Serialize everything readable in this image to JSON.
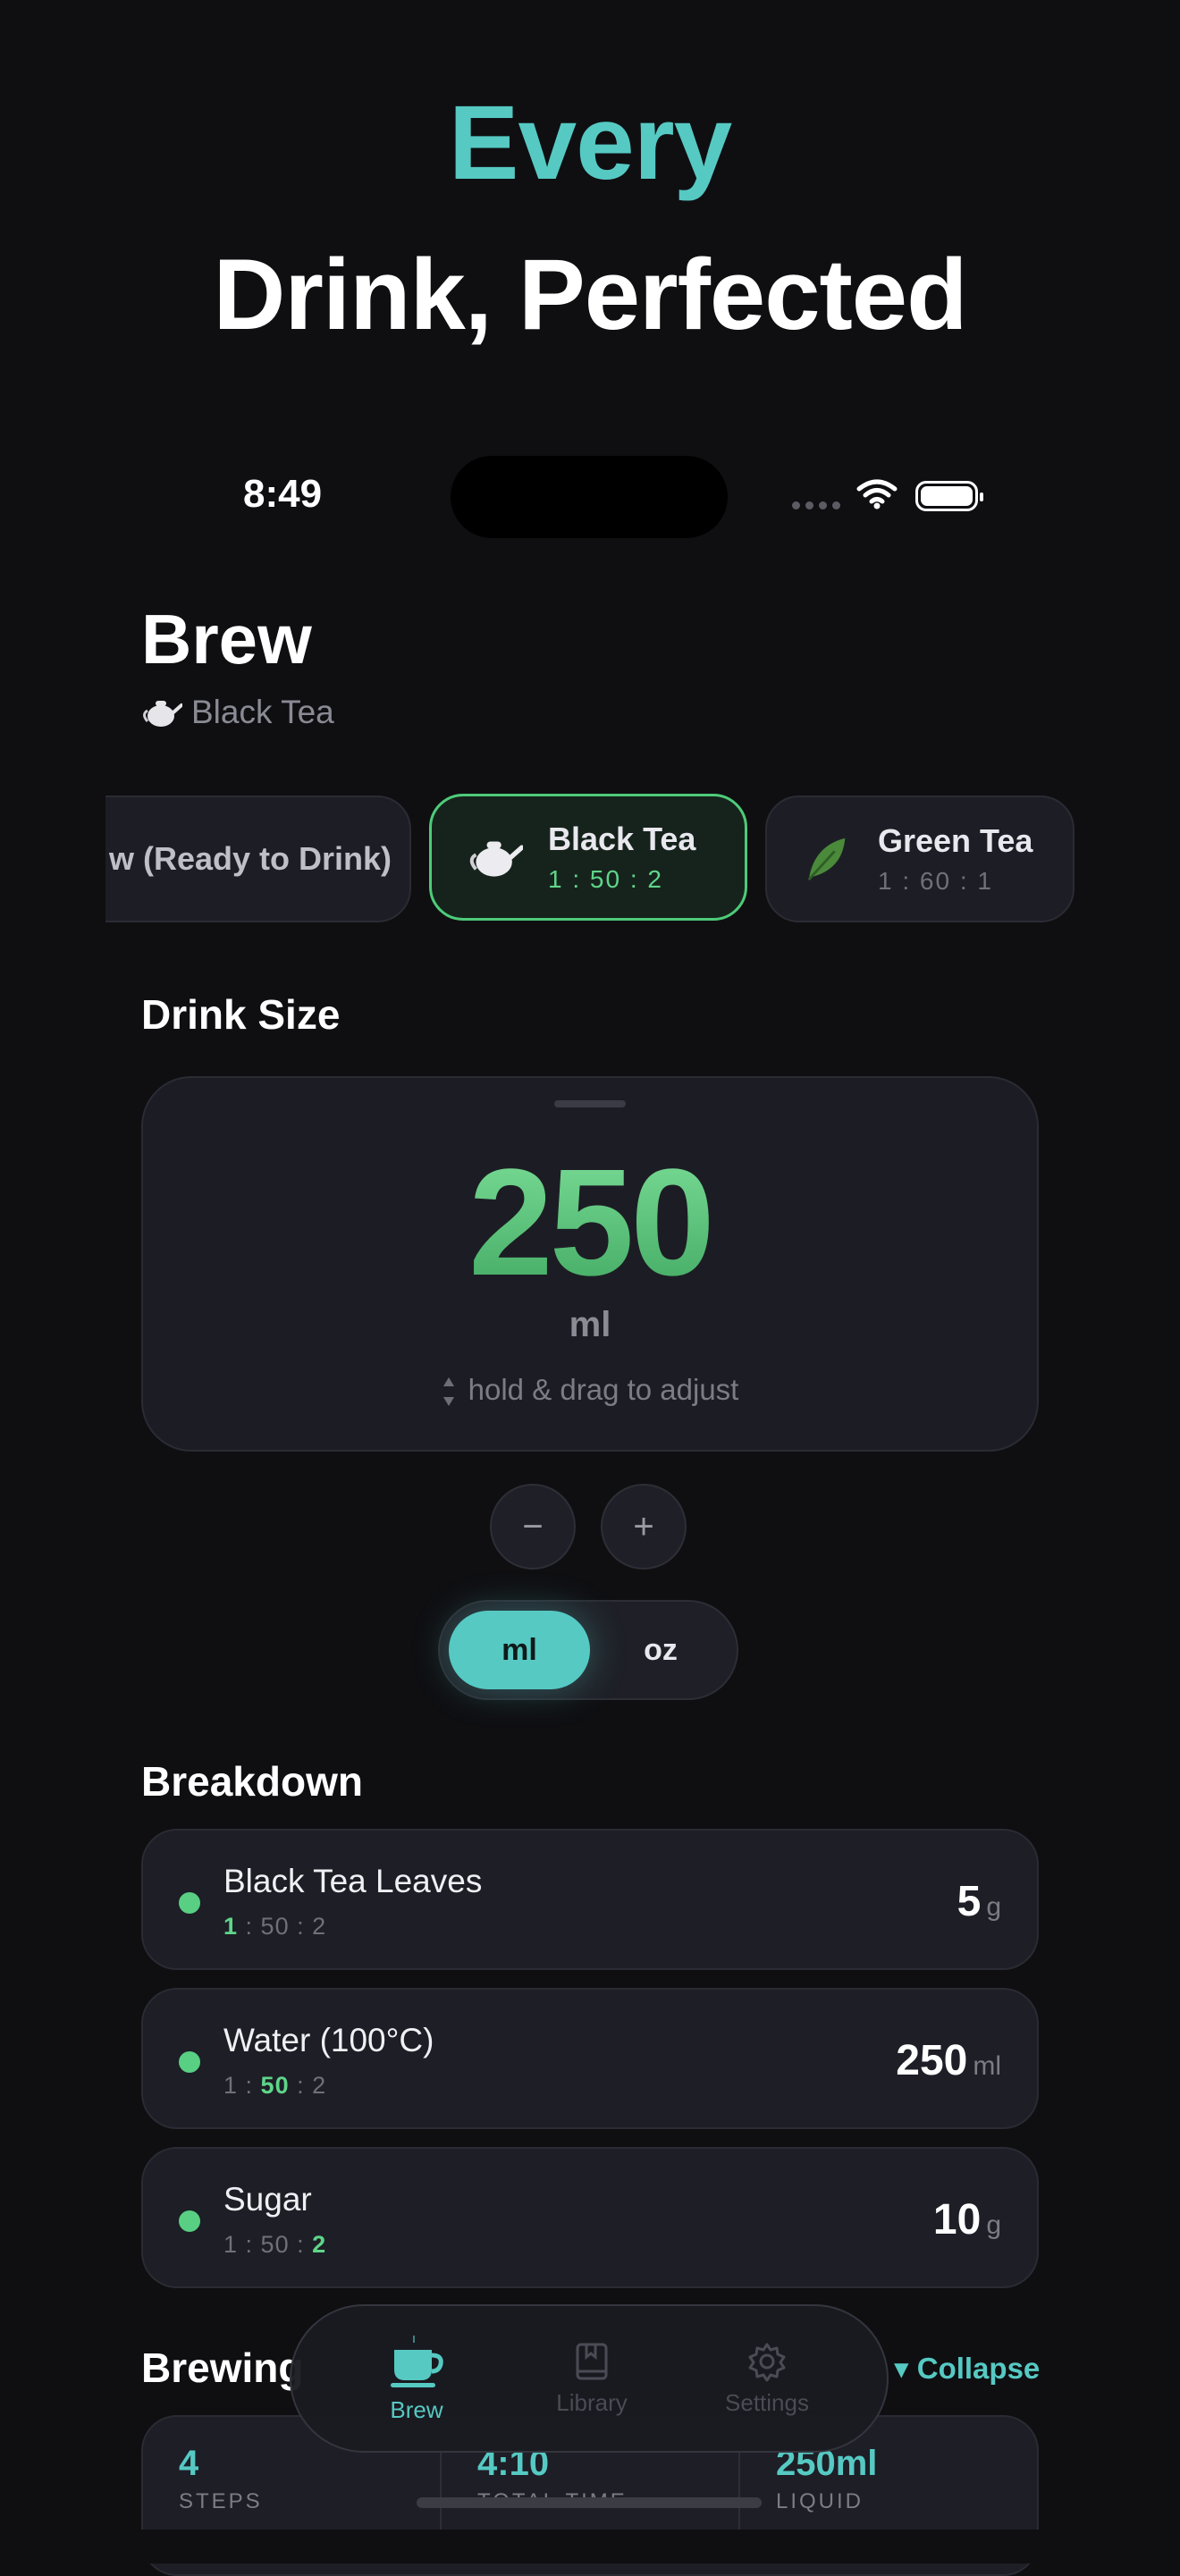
{
  "hero": {
    "line1": "Every",
    "line2": "Drink, Perfected"
  },
  "status_bar": {
    "time": "8:49"
  },
  "header": {
    "title": "Brew",
    "subtitle_icon": "teapot-icon",
    "subtitle": "Black Tea"
  },
  "drinks": [
    {
      "name": "w (Ready to Drink)",
      "ratio": "",
      "icon": "",
      "active": false
    },
    {
      "name": "Black Tea",
      "ratio": "1 : 50 : 2",
      "icon": "teapot-icon",
      "active": true
    },
    {
      "name": "Green Tea",
      "ratio": "1 : 60 : 1",
      "icon": "leaf-icon",
      "active": false
    }
  ],
  "drink_size": {
    "section_title": "Drink Size",
    "value": "250",
    "unit": "ml",
    "hint": "hold & drag to adjust",
    "decrement_label": "−",
    "increment_label": "+",
    "unit_toggle": {
      "options": [
        "ml",
        "oz"
      ],
      "selected": "ml"
    }
  },
  "breakdown": {
    "section_title": "Breakdown",
    "items": [
      {
        "name": "Black Tea Leaves",
        "ratio_parts": [
          "1",
          "50",
          "2"
        ],
        "highlight": 0,
        "amount": "5",
        "unit": "g"
      },
      {
        "name": "Water (100°C)",
        "ratio_parts": [
          "1",
          "50",
          "2"
        ],
        "highlight": 1,
        "amount": "250",
        "unit": "ml"
      },
      {
        "name": "Sugar",
        "ratio_parts": [
          "1",
          "50",
          "2"
        ],
        "highlight": 2,
        "amount": "10",
        "unit": "g"
      }
    ]
  },
  "brewing": {
    "section_title": "Brewing",
    "collapse_label": "Collapse",
    "stats": [
      {
        "value": "4",
        "label": "STEPS"
      },
      {
        "value": "4:10",
        "label": "TOTAL TIME"
      },
      {
        "value": "250ml",
        "label": "LIQUID"
      }
    ]
  },
  "tabbar": {
    "tabs": [
      {
        "label": "Brew",
        "icon": "cup-icon",
        "active": true
      },
      {
        "label": "Library",
        "icon": "book-icon",
        "active": false
      },
      {
        "label": "Settings",
        "icon": "gear-icon",
        "active": false
      }
    ]
  },
  "colors": {
    "accent_teal": "#56c9c3",
    "accent_green": "#58cf82",
    "background": "#0f0f12"
  }
}
